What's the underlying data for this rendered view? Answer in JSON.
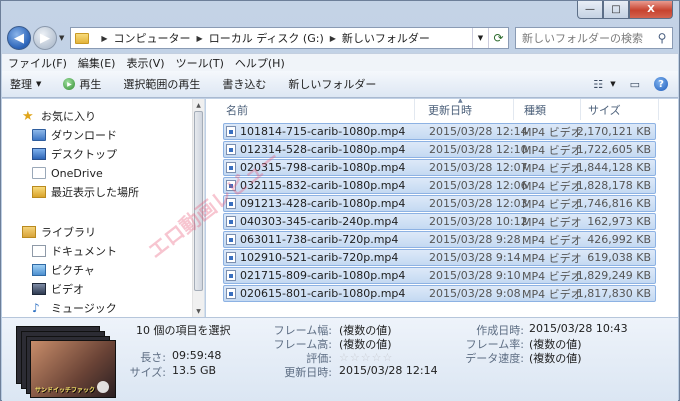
{
  "window": {
    "caption_buttons": {
      "minimize": "—",
      "maximize": "□",
      "close": "X"
    }
  },
  "address": {
    "breadcrumbs": [
      "コンピューター",
      "ローカル ディスク (G:)",
      "新しいフォルダー"
    ],
    "search_placeholder": "新しいフォルダーの検索"
  },
  "menubar": {
    "items": [
      "ファイル(F)",
      "編集(E)",
      "表示(V)",
      "ツール(T)",
      "ヘルプ(H)"
    ]
  },
  "toolbar": {
    "organize": "整理",
    "play": "再生",
    "play_selection": "選択範囲の再生",
    "burn": "書き込む",
    "new_folder": "新しいフォルダー"
  },
  "navpane": {
    "favorites": "お気に入り",
    "downloads": "ダウンロード",
    "desktop": "デスクトップ",
    "onedrive": "OneDrive",
    "recent": "最近表示した場所",
    "libraries": "ライブラリ",
    "documents": "ドキュメント",
    "pictures": "ピクチャ",
    "videos": "ビデオ",
    "music": "ミュージック"
  },
  "columns": {
    "name": "名前",
    "date": "更新日時",
    "type": "種類",
    "size": "サイズ"
  },
  "files": [
    {
      "name": "101814-715-carib-1080p.mp4",
      "date": "2015/03/28 12:14",
      "type": "MP4 ビデオ",
      "size": "2,170,121 KB"
    },
    {
      "name": "012314-528-carib-1080p.mp4",
      "date": "2015/03/28 12:10",
      "type": "MP4 ビデオ",
      "size": "1,722,605 KB"
    },
    {
      "name": "020315-798-carib-1080p.mp4",
      "date": "2015/03/28 12:07",
      "type": "MP4 ビデオ",
      "size": "1,844,128 KB"
    },
    {
      "name": "032115-832-carib-1080p.mp4",
      "date": "2015/03/28 12:06",
      "type": "MP4 ビデオ",
      "size": "1,828,178 KB"
    },
    {
      "name": "091213-428-carib-1080p.mp4",
      "date": "2015/03/28 12:03",
      "type": "MP4 ビデオ",
      "size": "1,746,816 KB"
    },
    {
      "name": "040303-345-carib-240p.mp4",
      "date": "2015/03/28 10:12",
      "type": "MP4 ビデオ",
      "size": "162,973 KB"
    },
    {
      "name": "063011-738-carib-720p.mp4",
      "date": "2015/03/28 9:28",
      "type": "MP4 ビデオ",
      "size": "426,992 KB"
    },
    {
      "name": "102910-521-carib-720p.mp4",
      "date": "2015/03/28 9:14",
      "type": "MP4 ビデオ",
      "size": "619,038 KB"
    },
    {
      "name": "021715-809-carib-1080p.mp4",
      "date": "2015/03/28 9:10",
      "type": "MP4 ビデオ",
      "size": "1,829,249 KB"
    },
    {
      "name": "020615-801-carib-1080p.mp4",
      "date": "2015/03/28 9:08",
      "type": "MP4 ビデオ",
      "size": "1,817,830 KB"
    }
  ],
  "details": {
    "selection": "10 個の項目を選択",
    "length_label": "長さ:",
    "length_value": "09:59:48",
    "size_label": "サイズ:",
    "size_value": "13.5 GB",
    "frame_width_label": "フレーム幅:",
    "frame_width_value": "(複数の値)",
    "frame_height_label": "フレーム高:",
    "frame_height_value": "(複数の値)",
    "rating_label": "評価:",
    "modified_label": "更新日時:",
    "modified_value": "2015/03/28 12:14",
    "created_label": "作成日時:",
    "created_value": "2015/03/28 10:43",
    "frame_rate_label": "フレーム率:",
    "frame_rate_value": "(複数の値)",
    "data_rate_label": "データ速度:",
    "data_rate_value": "(複数の値)",
    "thumb_caption": "サンドイッチファック"
  },
  "watermark": "エロ動画レビュー"
}
